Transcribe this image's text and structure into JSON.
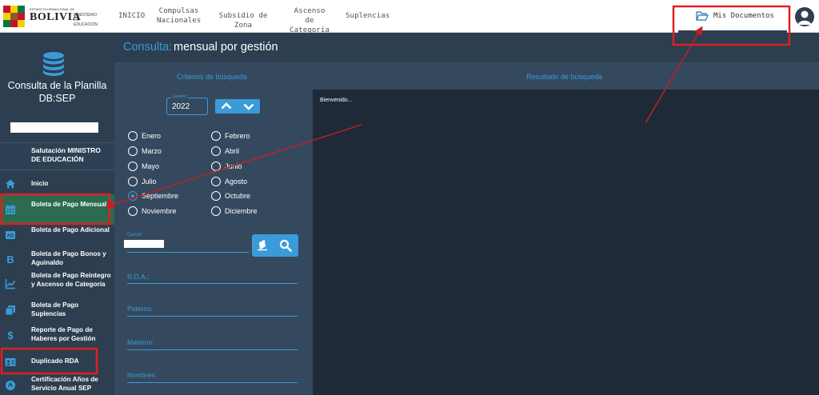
{
  "header": {
    "logo_sub": "ESTADO PLURINACIONAL DE",
    "logo_main": "BOLIVIA",
    "logo_min": "MINISTERIO DE EDUCACIÓN",
    "nav": [
      {
        "line1": "INICIO",
        "line2": ""
      },
      {
        "line1": "Compulsas",
        "line2": "Nacionales"
      },
      {
        "line1": "Subsidio de Zona",
        "line2": ""
      },
      {
        "line1": "Ascenso",
        "line2": "de Categoría"
      },
      {
        "line1": "Suplencias",
        "line2": ""
      }
    ],
    "mis_documentos": "Mis Documentos"
  },
  "sidebar": {
    "title_line1": "Consulta de la Planilla",
    "title_line2": "DB:SEP",
    "saludo": "Salutación MINISTRO DE EDUCACIÓN",
    "items": [
      {
        "label": "Inicio",
        "icon": "home-icon"
      },
      {
        "label": "Boleta de Pago Mensual",
        "icon": "calendar-icon"
      },
      {
        "label": "Boleta de Pago Adicional",
        "icon": "ad-icon"
      },
      {
        "label": "Boleta de Pago Bonos y Aguinaldo",
        "icon": "b-icon"
      },
      {
        "label": "Boleta de Pago Reintegro y Ascenso de Categoría",
        "icon": "chart-icon"
      },
      {
        "label": "Boleta de Pago Suplencias",
        "icon": "copy-icon"
      },
      {
        "label": "Reporte de Pago de Haberes por Gestión",
        "icon": "dollar-icon"
      },
      {
        "label": "Duplicado RDA",
        "icon": "id-card-icon"
      },
      {
        "label": "Certificación Años de Servicio Anual SEP",
        "icon": "circle-icon"
      }
    ]
  },
  "main": {
    "title_prefix": "Consulta:",
    "title": "mensual por gestión",
    "criteria_head": "Criterios de búsqueda",
    "results_head": "Resultado de búsqueda",
    "gestion_label": "Gestión",
    "gestion_value": "2022",
    "months": [
      "Enero",
      "Febrero",
      "Marzo",
      "Abril",
      "Mayo",
      "Junio",
      "Julio",
      "Agosto",
      "Septiembre",
      "Octubre",
      "Noviembre",
      "Diciembre"
    ],
    "selected_month": "Septiembre",
    "carnet_label": "Carnet",
    "rda_label": "R.D.A.:",
    "paterno_label": "Paterno:",
    "materno_label": "Materno:",
    "nombres_label": "Nombres:",
    "welcome": "Bienvenido..."
  },
  "colors": {
    "accent": "#3a9bd8",
    "sidebar": "#2c3e50",
    "panel": "#34495e",
    "active": "#2b6b50",
    "annotation": "#e02020"
  }
}
